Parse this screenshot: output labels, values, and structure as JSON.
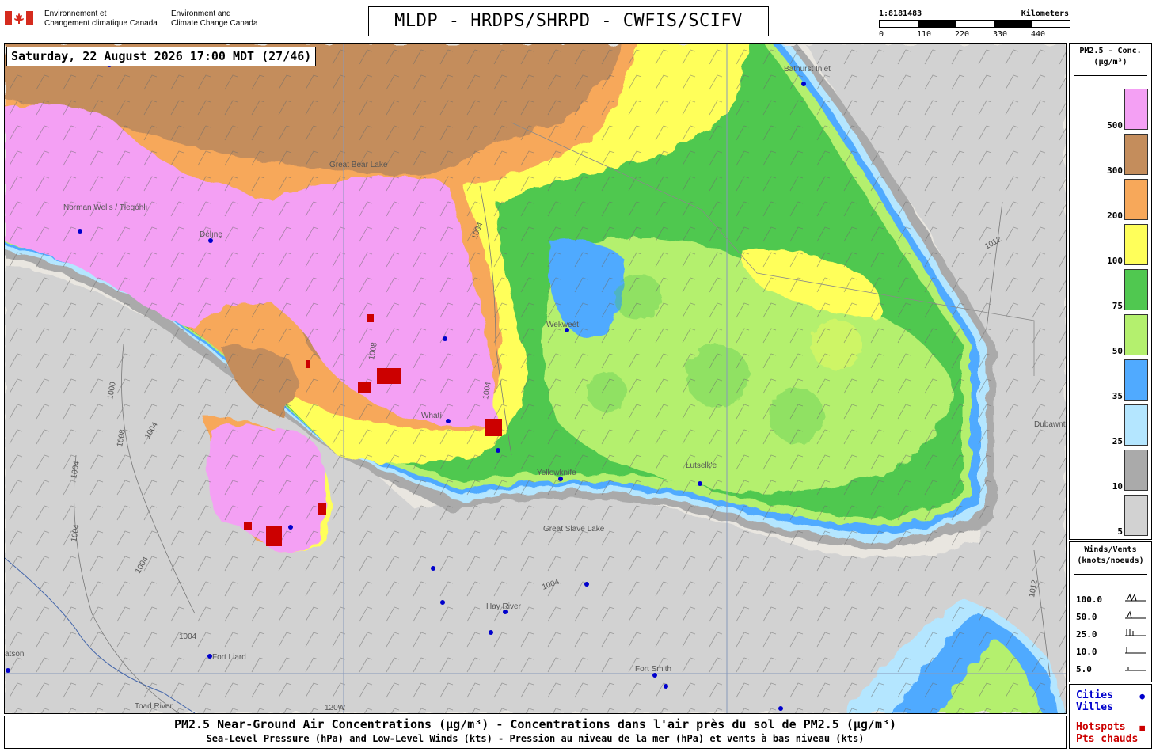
{
  "agency": {
    "french": "Environnement et\nChangement climatique Canada",
    "english": "Environment and\nClimate Change Canada"
  },
  "title": "MLDP - HRDPS/SHRPD - CWFIS/SCIFV",
  "scale": {
    "ratio": "1:8181483",
    "unit": "Kilometers",
    "ticks": [
      "0",
      "110",
      "220",
      "330",
      "440"
    ]
  },
  "timestamp": "Saturday, 22 August 2026 17:00 MDT (27/46)",
  "legend": {
    "title_line1": "PM2.5 - Conc.",
    "title_line2": "(µg/m³)",
    "levels": [
      {
        "value": "500",
        "color": "#f4a0f4"
      },
      {
        "value": "300",
        "color": "#c48d5c"
      },
      {
        "value": "200",
        "color": "#f7a85a"
      },
      {
        "value": "100",
        "color": "#ffff5a"
      },
      {
        "value": "75",
        "color": "#50c850"
      },
      {
        "value": "50",
        "color": "#b4f06e"
      },
      {
        "value": "35",
        "color": "#50aaff"
      },
      {
        "value": "25",
        "color": "#b4e6ff"
      },
      {
        "value": "10",
        "color": "#aaaaaa"
      },
      {
        "value": "5",
        "color": "#d2d2d2"
      }
    ]
  },
  "winds": {
    "title_line1": "Winds/Vents",
    "title_line2": "(knots/noeuds)",
    "rows": [
      "100.0",
      "50.0",
      "25.0",
      "10.0",
      "5.0"
    ]
  },
  "key": {
    "cities": "Cities",
    "villes": "Villes",
    "hotspots": "Hotspots",
    "pts": "Pts chauds",
    "cities_color": "#0000cc",
    "hotspots_color": "#cc0000"
  },
  "footer": {
    "line1": "PM2.5 Near-Ground Air Concentrations (µg/m³) - Concentrations dans l'air près du sol de PM2.5 (µg/m³)",
    "line2": "Sea-Level Pressure (hPa) and Low-Level Winds (kts) - Pression au niveau de la mer (hPa) et vents à bas niveau (kts)"
  },
  "map_labels": {
    "norman_wells": "Norman Wells / Tłegóhłı",
    "deline": "Délı̨nę",
    "wekweeti": "Wekweètì",
    "whati": "Whatì",
    "yellowknife": "Yellowknife",
    "lutselke": "Łutselk'e",
    "hay_river": "Hay River",
    "fort_liard": "Fort Liard",
    "fort_smith": "Fort Smith",
    "toad_river": "Toad River",
    "bathurst_inlet": "Bathurst Inlet",
    "dubawnt_lake": "Dubawnt Lake",
    "great_slave_lake": "Great Slave Lake",
    "great_bear_lake": "Great Bear Lake",
    "watson": "atson",
    "meridian": "120W",
    "isobars": [
      "1004",
      "1008",
      "1004",
      "1012",
      "1000",
      "1008",
      "1004",
      "1004",
      "1004",
      "1004",
      "1012",
      "1004",
      "1004"
    ]
  }
}
